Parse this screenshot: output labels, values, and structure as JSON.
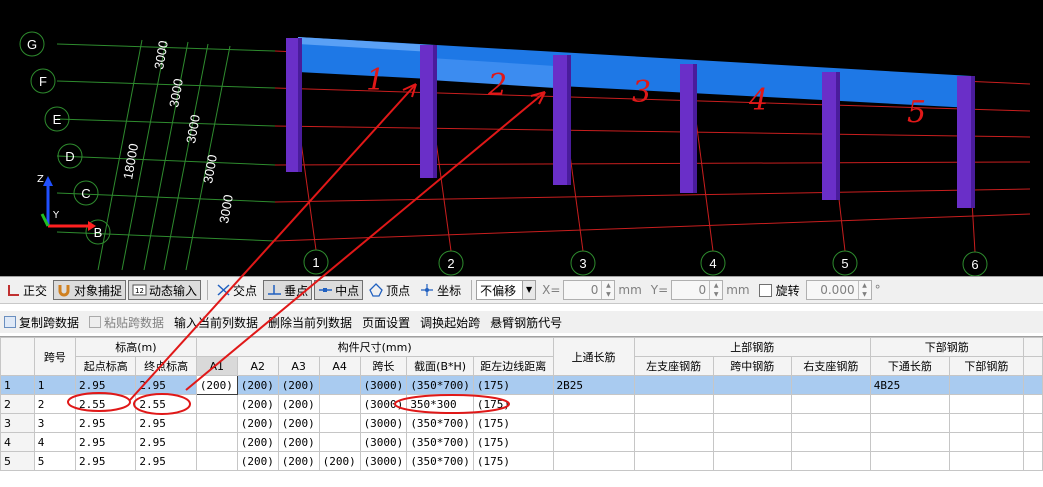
{
  "view3d": {
    "axis_rows": [
      "G",
      "F",
      "E",
      "D",
      "C",
      "B"
    ],
    "axis_cols": [
      "1",
      "2",
      "3",
      "4",
      "5",
      "6"
    ],
    "dims": [
      "3000",
      "3000",
      "3000",
      "3000",
      "3000"
    ],
    "total_dim": "18000",
    "beam_span_labels": [
      "1",
      "2",
      "3",
      "4",
      "5"
    ],
    "triad": {
      "z": "Z",
      "y": "Y"
    },
    "colors": {
      "background": "#000000",
      "grid_green": "#2e8b2e",
      "grid_red": "#c81e1e",
      "beam": "#1e78e6",
      "column": "#6a2fc8",
      "annotation": "#e01818"
    }
  },
  "snapbar": {
    "ortho": "正交",
    "snap": "对象捕捉",
    "dyn_input": "动态输入",
    "intersection": "交点",
    "perpendicular": "垂点",
    "midpoint": "中点",
    "vertex": "顶点",
    "coordinate": "坐标",
    "offset_mode": "不偏移",
    "x_label": "X=",
    "x_value": "0",
    "y_label": "Y=",
    "y_value": "0",
    "unit": "mm",
    "rotate_label": "旋转",
    "rotate_value": "0.000",
    "degree": "°"
  },
  "actionbar": {
    "copy_span": "复制跨数据",
    "paste_span": "粘贴跨数据",
    "input_column": "输入当前列数据",
    "delete_column": "删除当前列数据",
    "page_setup": "页面设置",
    "swap_start": "调换起始跨",
    "cantilever_code": "悬臂钢筋代号"
  },
  "grid": {
    "headers_top": {
      "span_no": "跨号",
      "elevation": "标高(m)",
      "dimension": "构件尺寸(mm)",
      "top_long_bar": "上通长筋",
      "top_bar": "上部钢筋",
      "bottom_bar": "下部钢筋"
    },
    "headers_sub": {
      "start_elev": "起点标高",
      "end_elev": "终点标高",
      "a1": "A1",
      "a2": "A2",
      "a3": "A3",
      "a4": "A4",
      "span_len": "跨长",
      "section": "截面(B*H)",
      "dist_left": "距左边线距离",
      "left_support": "左支座钢筋",
      "mid_span": "跨中钢筋",
      "right_support": "右支座钢筋",
      "bottom_long": "下通长筋",
      "bottom_part": "下部钢筋"
    },
    "rows": [
      {
        "n": "1",
        "span": "1",
        "start": "2.95",
        "end": "2.95",
        "a1": "(200)",
        "a2": "(200)",
        "a3": "(200)",
        "a4": "",
        "len": "(3000)",
        "section": "(350*700)",
        "dist": "(175)",
        "top_long": "2B25",
        "left_sup": "",
        "mid": "",
        "right_sup": "",
        "bot_long": "4B25",
        "bot": ""
      },
      {
        "n": "2",
        "span": "2",
        "start": "2.55",
        "end": "2.55",
        "a1": "",
        "a2": "(200)",
        "a3": "(200)",
        "a4": "",
        "len": "(3000)",
        "section": "350*300",
        "dist": "(175)",
        "top_long": "",
        "left_sup": "",
        "mid": "",
        "right_sup": "",
        "bot_long": "",
        "bot": ""
      },
      {
        "n": "3",
        "span": "3",
        "start": "2.95",
        "end": "2.95",
        "a1": "",
        "a2": "(200)",
        "a3": "(200)",
        "a4": "",
        "len": "(3000)",
        "section": "(350*700)",
        "dist": "(175)",
        "top_long": "",
        "left_sup": "",
        "mid": "",
        "right_sup": "",
        "bot_long": "",
        "bot": ""
      },
      {
        "n": "4",
        "span": "4",
        "start": "2.95",
        "end": "2.95",
        "a1": "",
        "a2": "(200)",
        "a3": "(200)",
        "a4": "",
        "len": "(3000)",
        "section": "(350*700)",
        "dist": "(175)",
        "top_long": "",
        "left_sup": "",
        "mid": "",
        "right_sup": "",
        "bot_long": "",
        "bot": ""
      },
      {
        "n": "5",
        "span": "5",
        "start": "2.95",
        "end": "2.95",
        "a1": "",
        "a2": "(200)",
        "a3": "(200)",
        "a4": "(200)",
        "len": "(3000)",
        "section": "(350*700)",
        "dist": "(175)",
        "top_long": "",
        "left_sup": "",
        "mid": "",
        "right_sup": "",
        "bot_long": "",
        "bot": ""
      }
    ],
    "selected_row": 1
  }
}
